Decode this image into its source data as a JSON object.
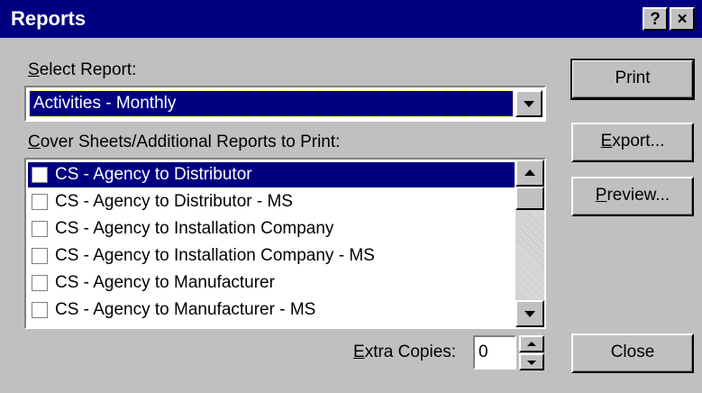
{
  "window": {
    "title": "Reports",
    "help_label": "?",
    "close_label": "×"
  },
  "select_report": {
    "label_prefix": "",
    "label_accel": "S",
    "label_rest": "elect Report:",
    "value": "Activities - Monthly"
  },
  "cover": {
    "label_accel": "C",
    "label_rest": "over Sheets/Additional Reports to Print:",
    "items": [
      {
        "label": "CS - Agency to Distributor",
        "checked": false,
        "selected": true
      },
      {
        "label": "CS - Agency to Distributor - MS",
        "checked": false,
        "selected": false
      },
      {
        "label": "CS - Agency to Installation Company",
        "checked": false,
        "selected": false
      },
      {
        "label": "CS - Agency to Installation Company - MS",
        "checked": false,
        "selected": false
      },
      {
        "label": "CS - Agency to Manufacturer",
        "checked": false,
        "selected": false
      },
      {
        "label": "CS - Agency to Manufacturer - MS",
        "checked": false,
        "selected": false
      }
    ]
  },
  "buttons": {
    "print": {
      "label": "Print"
    },
    "export": {
      "accel": "E",
      "rest": "xport..."
    },
    "preview": {
      "accel": "P",
      "rest": "review..."
    },
    "close": {
      "label": "Close"
    }
  },
  "extra_copies": {
    "label_accel": "E",
    "label_rest": "xtra Copies:",
    "value": "0"
  },
  "colors": {
    "titlebar": "#000080",
    "face": "#c0c0c0",
    "selection": "#000080"
  }
}
